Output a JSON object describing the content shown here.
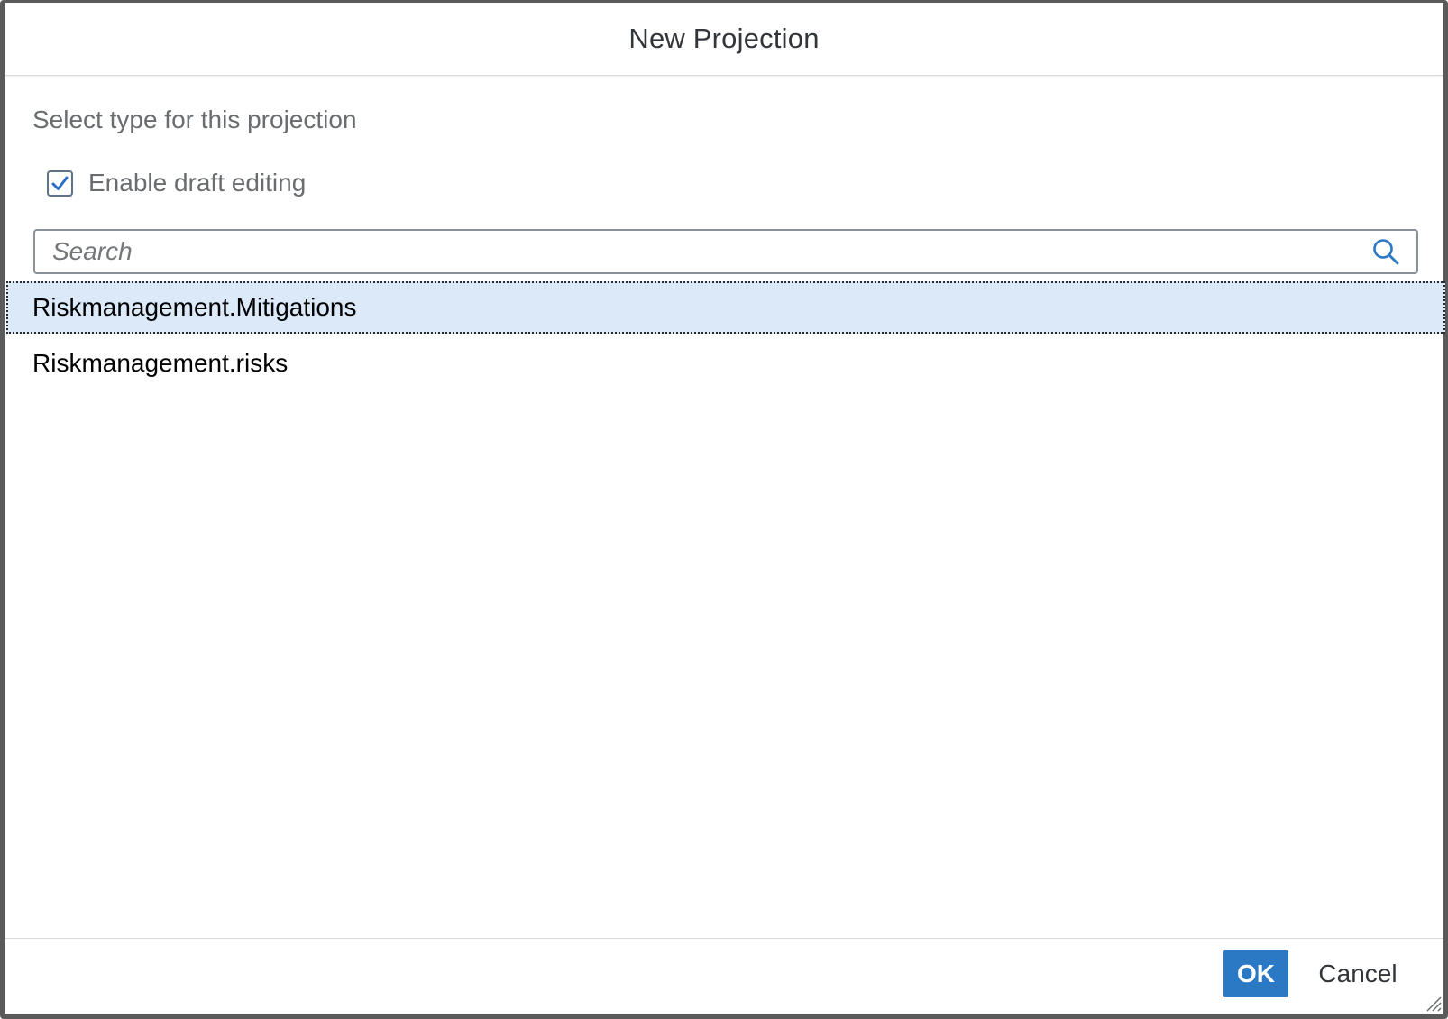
{
  "dialog": {
    "title": "New Projection",
    "subtitle": "Select type for this projection"
  },
  "draft_option": {
    "label": "Enable draft editing",
    "checked": true
  },
  "search": {
    "placeholder": "Search",
    "value": "",
    "icon": "search-icon"
  },
  "list": {
    "items": [
      {
        "label": "Riskmanagement.Mitigations",
        "selected": true
      },
      {
        "label": "Riskmanagement.risks",
        "selected": false
      }
    ]
  },
  "footer": {
    "ok_label": "OK",
    "cancel_label": "Cancel"
  },
  "colors": {
    "accent": "#2b78c5",
    "selection": "#dbe9f9",
    "checkmark": "#2b6fc4",
    "border": "#5a5a5a"
  }
}
